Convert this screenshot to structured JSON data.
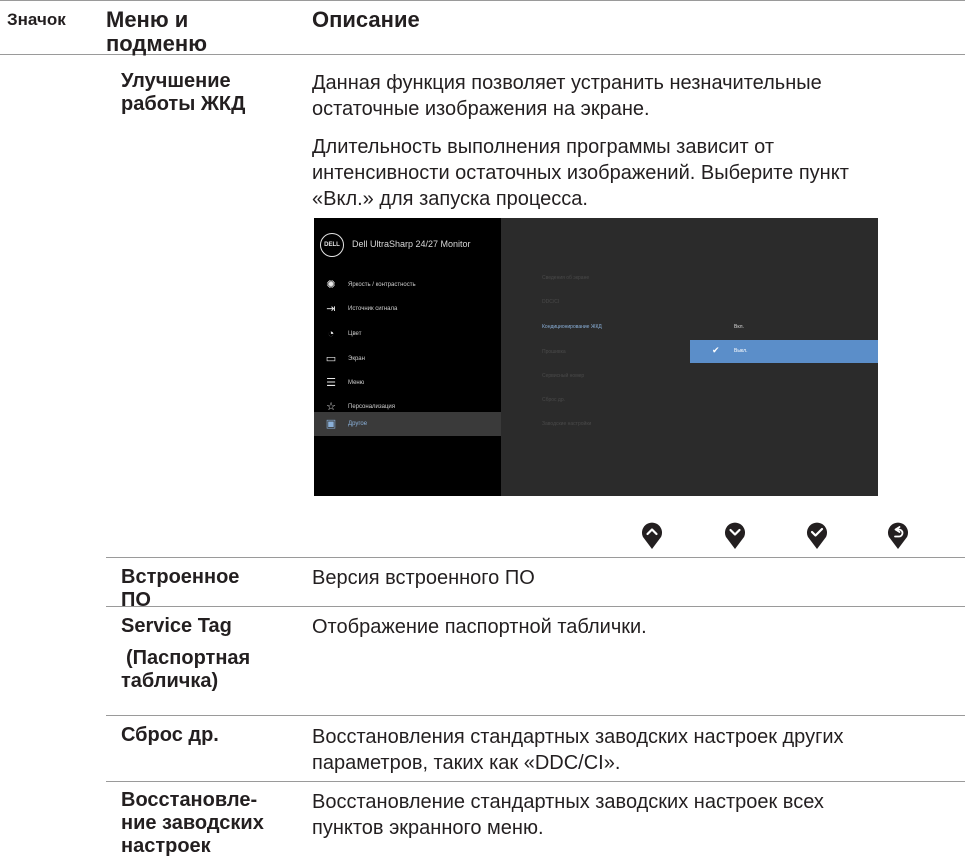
{
  "header": {
    "col_icon": "Значок",
    "col_menu": "Меню и подменю",
    "col_menu_line1": "Меню и",
    "col_menu_line2": "подменю",
    "col_desc": "Описание"
  },
  "lcd": {
    "menu_line1": "Улучшение",
    "menu_line2": "работы ЖКД",
    "desc1_line1": "Данная функция позволяет устранить незначительные",
    "desc1_line2": "остаточные изображения на экране.",
    "desc2_line1": "Длительность выполнения программы зависит от",
    "desc2_line2": "интенсивности остаточных изображений. Выберите пункт",
    "desc2_line3": "«Вкл.» для запуска процесса."
  },
  "osd": {
    "logo": "DELL",
    "title": "Dell UltraSharp 24/27 Monitor",
    "menu_items": [
      {
        "label": "Яркость / контрастность",
        "icon": "sun-icon"
      },
      {
        "label": "Источник сигнала",
        "icon": "input-source-icon"
      },
      {
        "label": "Цвет",
        "icon": "palette-icon"
      },
      {
        "label": "Экран",
        "icon": "display-icon"
      },
      {
        "label": "Меню",
        "icon": "menu-list-icon"
      },
      {
        "label": "Персонализация",
        "icon": "star-icon"
      },
      {
        "label": "Другое",
        "icon": "other-info-icon"
      }
    ],
    "selected_menu": "Другое",
    "submenu": [
      "Сведения об экране",
      "DDC/CI",
      "Кондиционирование ЖКД",
      "Прошивка",
      "Сервисный номер",
      "Сброс др.",
      "Заводские настройки"
    ],
    "active_submenu": "Кондиционирование ЖКД",
    "options": [
      "Вкл.",
      "Выкл."
    ],
    "selected_option": "Выкл.",
    "colors": {
      "panel": "#2b2b2b",
      "sidebar": "#000000",
      "highlight": "#5b8ec9",
      "accent_text": "#8ab0d9"
    }
  },
  "nav_buttons": [
    "up-button-icon",
    "down-button-icon",
    "check-button-icon",
    "back-button-icon"
  ],
  "rows": [
    {
      "menu_line1": "Встроенное",
      "menu_line2": "ПО",
      "desc_line1": "Версия встроенного ПО",
      "desc_line2": ""
    },
    {
      "menu_line1": "Service Tag",
      "menu_line2": "(Паспортная",
      "menu_line3": "табличка)",
      "desc_line1": "Отображение паспортной таблички.",
      "desc_line2": ""
    },
    {
      "menu_line1": "Сброс др.",
      "menu_line2": "",
      "desc_line1": "Восстановления стандартных заводских настроек других",
      "desc_line2": "параметров, таких как «DDC/CI»."
    },
    {
      "menu_line1": "Восстановле-",
      "menu_line2": "ние заводских",
      "menu_line3": "настроек",
      "desc_line1": "Восстановление стандартных заводских настроек всех",
      "desc_line2": "пунктов экранного меню."
    }
  ]
}
